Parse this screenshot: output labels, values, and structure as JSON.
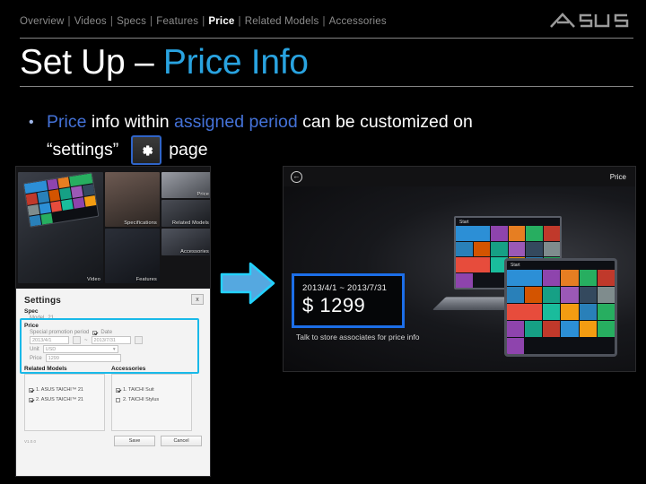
{
  "header": {
    "nav_items": [
      {
        "label": "Overview",
        "active": false
      },
      {
        "label": "Videos",
        "active": false
      },
      {
        "label": "Specs",
        "active": false
      },
      {
        "label": "Features",
        "active": false
      },
      {
        "label": "Price",
        "active": true
      },
      {
        "label": "Related Models",
        "active": false
      },
      {
        "label": "Accessories",
        "active": false
      }
    ],
    "separator": "|",
    "logo": "asus-logo"
  },
  "title": {
    "prefix": "Set Up – ",
    "highlight": "Price Info"
  },
  "bullet": {
    "marker": "•",
    "line1": {
      "seg1": "Price",
      "seg2": " info within ",
      "seg3": "assigned period",
      "seg4": " can be customized  on"
    },
    "line2": {
      "seg1": "“settings”",
      "icon": "gear-icon",
      "seg2": "page"
    }
  },
  "left_shot": {
    "tiles": [
      {
        "label": "Video",
        "name": "tile-video"
      },
      {
        "label": "Specifications",
        "name": "tile-specifications"
      },
      {
        "label": "Price",
        "name": "tile-price"
      },
      {
        "label": "Features",
        "name": "tile-features"
      },
      {
        "label": "Related Models",
        "name": "tile-related-models"
      },
      {
        "label": "Accessories",
        "name": "tile-accessories"
      }
    ],
    "dialog": {
      "title": "Settings",
      "close_label": "x",
      "spec_section": "Spec",
      "model_row_label": "Model",
      "model_row_value": "21",
      "price_section": "Price",
      "promo_label": "Special promotion period",
      "promo_checkbox_label": "Date",
      "date_start_placeholder": "2013/4/1",
      "date_tilde": "~",
      "date_end_placeholder": "2013/7/31",
      "unit_label": "Unit",
      "unit_value": "USD",
      "price_label": "Price",
      "price_value": "1299",
      "related_models_header": "Related Models",
      "accessories_header": "Accessories",
      "related_models": [
        {
          "label": "1. ASUS TAICHI™ 21",
          "checked": true
        },
        {
          "label": "2. ASUS TAICHI™ 21",
          "checked": true
        }
      ],
      "accessories": [
        {
          "label": "1. TAICHI Suit",
          "checked": true
        },
        {
          "label": "2. TAICHI Stylus",
          "checked": false
        }
      ],
      "version": "V1.0.0",
      "save_label": "Save",
      "cancel_label": "Cancel"
    }
  },
  "arrow": {
    "name": "blue-right-arrow"
  },
  "right_shot": {
    "back_icon": "back-arrow-icon",
    "page_title": "Price",
    "period": "2013/4/1 ~ 2013/7/31",
    "amount": "$ 1299",
    "note": "Talk to store associates for price info",
    "device_label_1": "Start",
    "device_label_2": "Start"
  },
  "colors": {
    "title_accent": "#29a3e2",
    "bullet_accent": "#4472d8",
    "highlight_box_left": "#19b9e8",
    "highlight_box_right": "#1c6ee8",
    "arrow": "#4aa8e8",
    "background": "#000000"
  }
}
